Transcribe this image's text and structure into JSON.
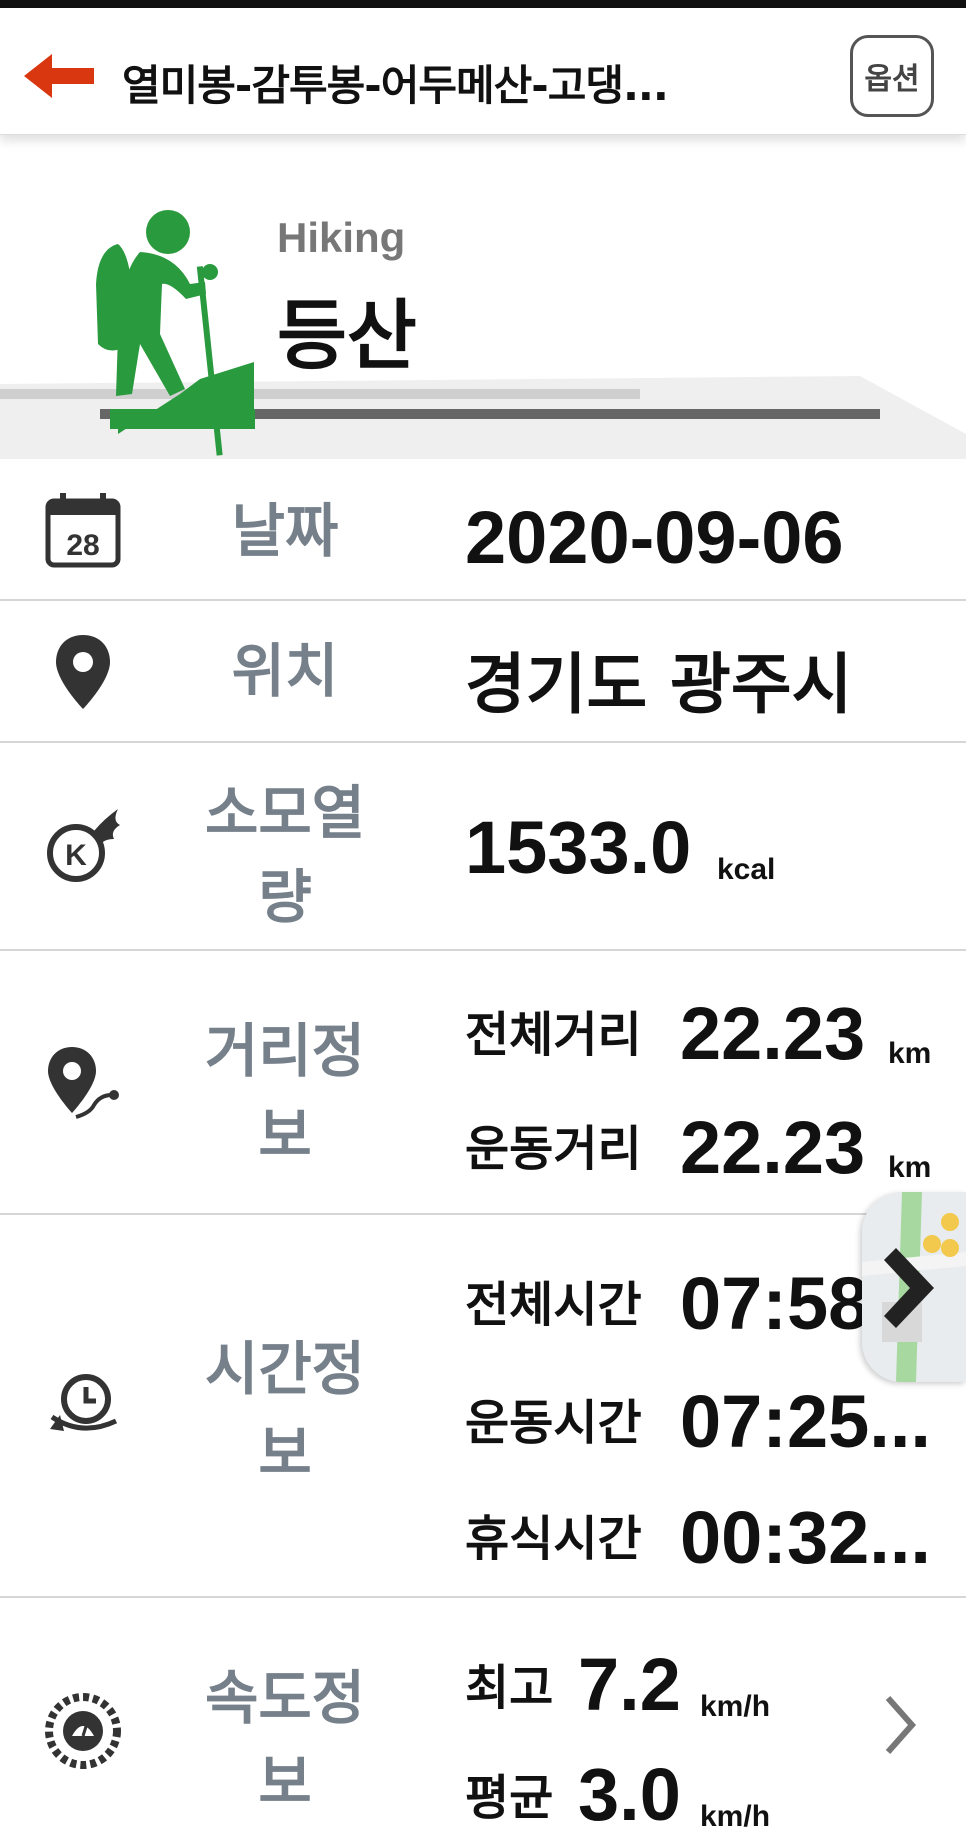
{
  "header": {
    "title": "열미봉-감투봉-어두메산-고댕...",
    "option_label": "옵션"
  },
  "hero": {
    "sub": "Hiking",
    "title": "등산"
  },
  "rows": {
    "date": {
      "label": "날짜",
      "value": "2020-09-06",
      "calendar_day": "28"
    },
    "location": {
      "label": "위치",
      "value": "경기도 광주시"
    },
    "calories": {
      "label_line1": "소모열",
      "label_line2": "량",
      "value": "1533.0",
      "unit": "kcal"
    },
    "distance": {
      "label_line1": "거리정",
      "label_line2": "보",
      "total_label": "전체거리",
      "total_value": "22.23",
      "total_unit": "km",
      "move_label": "운동거리",
      "move_value": "22.23",
      "move_unit": "km"
    },
    "time": {
      "label_line1": "시간정",
      "label_line2": "보",
      "total_label": "전체시간",
      "total_value": "07:58",
      "move_label": "운동시간",
      "move_value": "07:25...",
      "rest_label": "휴식시간",
      "rest_value": "00:32..."
    },
    "speed": {
      "label_line1": "속도정",
      "label_line2": "보",
      "max_label": "최고",
      "max_value": "7.2",
      "max_unit": "km/h",
      "avg_label": "평균",
      "avg_value": "3.0",
      "avg_unit": "km/h"
    }
  },
  "icons": {
    "back": "back-arrow-icon",
    "calendar": "calendar-icon",
    "location": "location-pin-icon",
    "calorie": "calorie-fire-icon",
    "distance": "distance-route-icon",
    "time": "clock-icon",
    "speed": "speedometer-icon"
  },
  "colors": {
    "accent_arrow": "#d9370f",
    "hiker_green": "#2a9a3e",
    "label_gray": "#76808a"
  }
}
